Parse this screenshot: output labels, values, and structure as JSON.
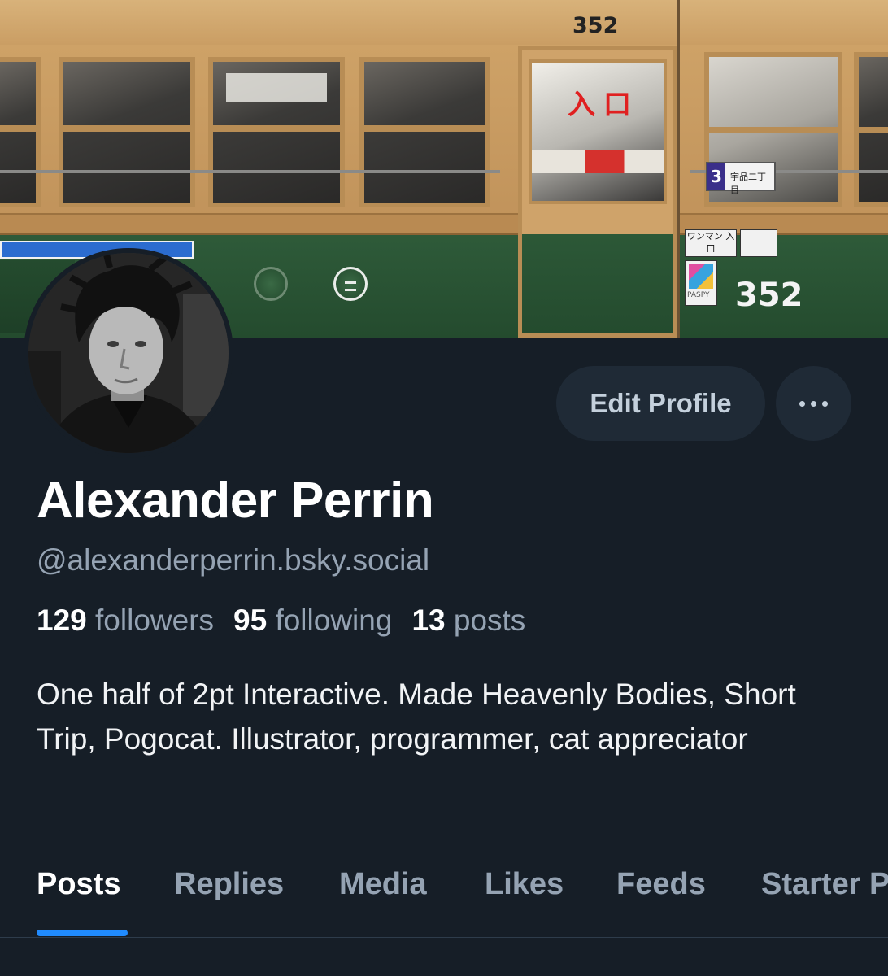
{
  "banner": {
    "tram_number_top": "352",
    "tram_number_bottom": "352",
    "entrance_sign": "入口",
    "stop_sign_number": "3",
    "stop_sign_text": "宇品二丁目",
    "wanman_sign": "ワンマン 入口",
    "card_sign": "PASPY"
  },
  "profile": {
    "display_name": "Alexander Perrin",
    "handle": "@alexanderperrin.bsky.social",
    "stats": {
      "followers_count": "129",
      "followers_label": "followers",
      "following_count": "95",
      "following_label": "following",
      "posts_count": "13",
      "posts_label": "posts"
    },
    "bio": "One half of 2pt Interactive. Made Heavenly Bodies, Short Trip, Pogocat. Illustrator, programmer, cat appreciator"
  },
  "actions": {
    "edit_label": "Edit Profile",
    "more_icon": "ellipsis-icon"
  },
  "tabs": [
    {
      "label": "Posts",
      "active": true
    },
    {
      "label": "Replies",
      "active": false
    },
    {
      "label": "Media",
      "active": false
    },
    {
      "label": "Likes",
      "active": false
    },
    {
      "label": "Feeds",
      "active": false
    },
    {
      "label": "Starter Packs",
      "active": false
    }
  ],
  "colors": {
    "background": "#161e27",
    "button_bg": "#1f2a36",
    "muted_text": "#95a3b3",
    "accent": "#208bfe"
  }
}
